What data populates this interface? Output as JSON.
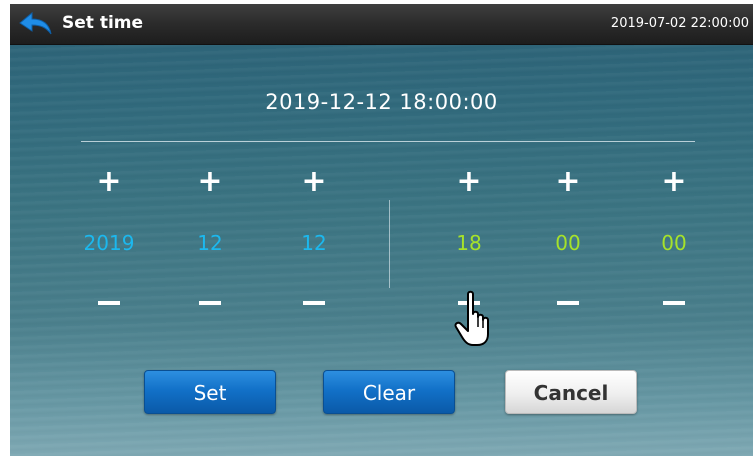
{
  "header": {
    "title": "Set time",
    "clock": "2019-07-02 22:00:00",
    "back_icon": "back-arrow-icon"
  },
  "current_display": "2019-12-12  18:00:00",
  "fields": {
    "year": "2019",
    "month": "12",
    "day": "12",
    "hour": "18",
    "minute": "00",
    "second": "00"
  },
  "controls": {
    "plus": "+",
    "minus_icon": "minus-icon"
  },
  "buttons": {
    "set": "Set",
    "clear": "Clear",
    "cancel": "Cancel"
  },
  "colors": {
    "date_value": "#1cb8ee",
    "time_value": "#a6e22a",
    "button_blue": "#1271c8"
  },
  "pointer_icon": "hand-pointer-icon"
}
